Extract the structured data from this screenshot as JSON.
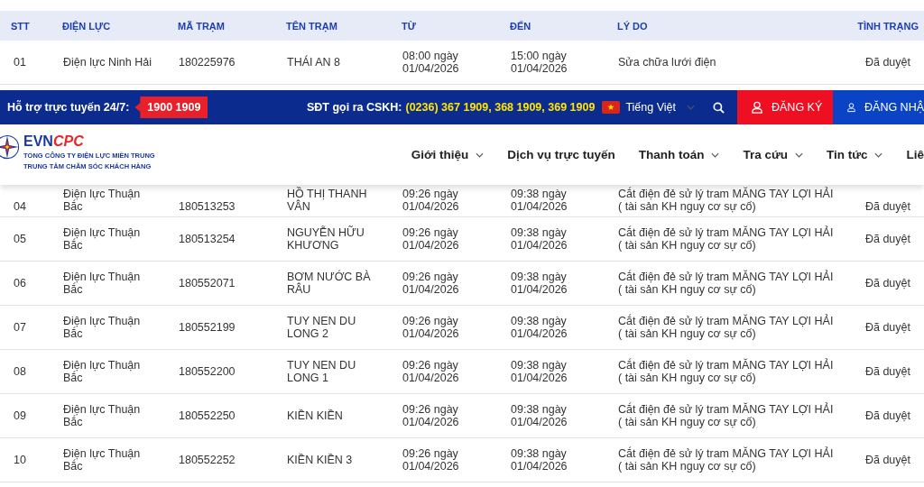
{
  "table": {
    "columns": [
      "STT",
      "ĐIỆN LỰC",
      "MÃ TRẠM",
      "TÊN TRẠM",
      "TỪ",
      "ĐẾN",
      "LÝ DO",
      "TÌNH TRẠNG"
    ],
    "rows": [
      {
        "cells": [
          "01",
          "Điện lực Ninh Hải",
          "180225976",
          "THÁI AN 8",
          "08:00 ngày\n01/04/2026",
          "15:00 ngày\n01/04/2026",
          "Sửa chữa lưới điện",
          "Đã duyệt"
        ]
      },
      {
        "cells": [
          "04",
          "Điện lực Thuận\nBắc",
          "180513253",
          "HỒ THỊ THANH\nVÂN",
          "09:26 ngày\n01/04/2026",
          "09:38 ngày\n01/04/2026",
          "Cắt điện đẻ sử lý tram MĂNG TAY LỢI HẢI\n( tài sản KH nguy cơ sự cố)",
          "Đã duyệt"
        ]
      },
      {
        "cells": [
          "05",
          "Điện lực Thuận\nBắc",
          "180513254",
          "NGUYỄN HỮU\nKHƯƠNG",
          "09:26 ngày\n01/04/2026",
          "09:38 ngày\n01/04/2026",
          "Cắt điện đẻ sử lý tram MĂNG TAY LỢI HẢI\n( tài sản KH nguy cơ sự cố)",
          "Đã duyệt"
        ]
      },
      {
        "cells": [
          "06",
          "Điện lực Thuận\nBắc",
          "180552071",
          "BƠM NƯỚC BÀ\nRÂU",
          "09:26 ngày\n01/04/2026",
          "09:38 ngày\n01/04/2026",
          "Cắt điện đẻ sử lý tram MĂNG TAY LỢI HẢI\n( tài sản KH nguy cơ sự cố)",
          "Đã duyệt"
        ]
      },
      {
        "cells": [
          "07",
          "Điện lực Thuận\nBắc",
          "180552199",
          "TUY NEN DU\nLONG 2",
          "09:26 ngày\n01/04/2026",
          "09:38 ngày\n01/04/2026",
          "Cắt điện đẻ sử lý tram MĂNG TAY LỢI HẢI\n( tài sản KH nguy cơ sự cố)",
          "Đã duyệt"
        ]
      },
      {
        "cells": [
          "08",
          "Điện lực Thuận\nBắc",
          "180552200",
          "TUY NEN DU\nLONG 1",
          "09:26 ngày\n01/04/2026",
          "09:38 ngày\n01/04/2026",
          "Cắt điện đẻ sử lý tram MĂNG TAY LỢI HẢI\n( tài sản KH nguy cơ sự cố)",
          "Đã duyệt"
        ]
      },
      {
        "cells": [
          "09",
          "Điện lực Thuận\nBắc",
          "180552250",
          "KIỀN KIỀN",
          "09:26 ngày\n01/04/2026",
          "09:38 ngày\n01/04/2026",
          "Cắt điện đẻ sử lý tram MĂNG TAY LỢI HẢI\n( tài sản KH nguy cơ sự cố)",
          "Đã duyệt"
        ]
      },
      {
        "cells": [
          "10",
          "Điện lực Thuận\nBắc",
          "180552252",
          "KIỀN KIỀN 3",
          "09:26 ngày\n01/04/2026",
          "09:38 ngày\n01/04/2026",
          "Cắt điện đẻ sử lý tram MĂNG TAY LỢI HẢI\n( tài sản KH nguy cơ sự cố)",
          "Đã duyệt"
        ]
      }
    ]
  },
  "top_bar": {
    "support_label": "Hỗ trợ trực tuyến 24/7:",
    "hotline": "1900 1909",
    "cskh_label": "SĐT gọi ra CSKH:",
    "cskh_numbers": "(0236) 367 1909, 368 1909, 369 1909",
    "language": "Tiếng Việt",
    "register": "ĐĂNG KÝ",
    "login": "ĐĂNG NHẬ"
  },
  "logo": {
    "name_part_1": "EVN",
    "name_part_2": "CPC",
    "subtitle_lines": [
      "TỔNG CÔNG TY ĐIỆN LỰC MIỀN TRUNG",
      "TRUNG TÂM CHĂM SÓC KHÁCH HÀNG"
    ]
  },
  "nav": [
    {
      "label": "Giới thiệu",
      "has_dropdown": true
    },
    {
      "label": "Dịch vụ trực tuyến",
      "has_dropdown": false
    },
    {
      "label": "Thanh toán",
      "has_dropdown": true
    },
    {
      "label": "Tra cứu",
      "has_dropdown": true
    },
    {
      "label": "Tin tức",
      "has_dropdown": true
    },
    {
      "label": "Liê",
      "has_dropdown": false
    }
  ]
}
